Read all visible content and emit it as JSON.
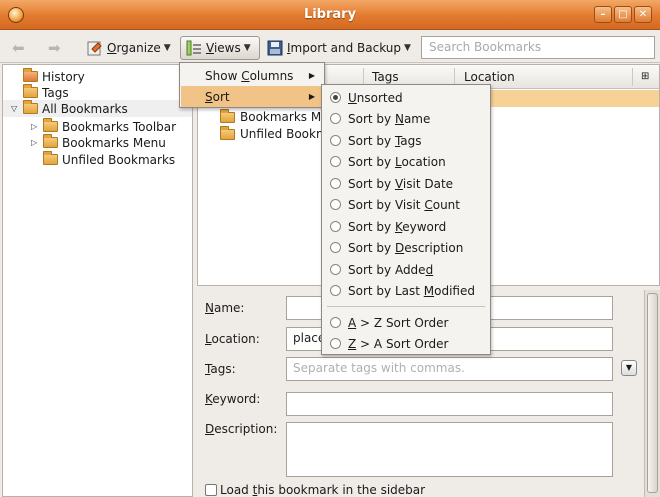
{
  "window": {
    "title": "Library"
  },
  "toolbar": {
    "organize_label": "Organize",
    "organize_key": "O",
    "views_label": "Views",
    "views_key": "V",
    "import_label": "Import and Backup",
    "import_key": "I",
    "search_placeholder": "Search Bookmarks"
  },
  "sidebar": {
    "items": [
      {
        "label": "History"
      },
      {
        "label": "Tags"
      },
      {
        "label": "All Bookmarks"
      },
      {
        "label": "Bookmarks Toolbar"
      },
      {
        "label": "Bookmarks Menu"
      },
      {
        "label": "Unfiled Bookmarks"
      }
    ]
  },
  "list": {
    "columns": [
      "Tags",
      "Location"
    ],
    "rows": [
      {
        "label": "Bookmarks Me"
      },
      {
        "label": "Unfiled Bookm"
      }
    ]
  },
  "details": {
    "name_label": "Name:",
    "location_label": "Location:",
    "location_value": "place",
    "tags_label": "Tags:",
    "tags_placeholder": "Separate tags with commas.",
    "keyword_label": "Keyword:",
    "description_label": "Description:",
    "load_sidebar_label": "Load this bookmark in the sidebar"
  },
  "views_menu": {
    "items": [
      {
        "label": "Show Columns"
      },
      {
        "label": "Sort"
      }
    ]
  },
  "sort_menu": {
    "selected": "Unsorted",
    "items": [
      {
        "label": "Unsorted"
      },
      {
        "label": "Sort by Name"
      },
      {
        "label": "Sort by Tags"
      },
      {
        "label": "Sort by Location"
      },
      {
        "label": "Sort by Visit Date"
      },
      {
        "label": "Sort by Visit Count"
      },
      {
        "label": "Sort by Keyword"
      },
      {
        "label": "Sort by Description"
      },
      {
        "label": "Sort by Added"
      },
      {
        "label": "Sort by Last Modified"
      }
    ],
    "order_items": [
      {
        "label": "A > Z Sort Order"
      },
      {
        "label": "Z > A Sort Order"
      }
    ]
  }
}
